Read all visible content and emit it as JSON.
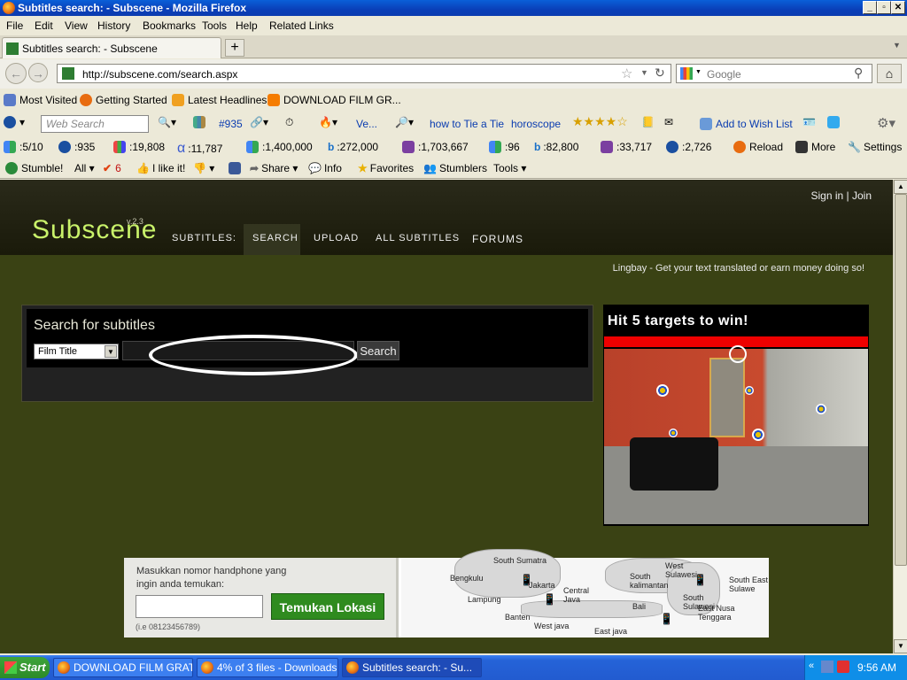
{
  "window": {
    "title": "Subtitles search: - Subscene - Mozilla Firefox"
  },
  "menu": [
    "File",
    "Edit",
    "View",
    "History",
    "Bookmarks",
    "Tools",
    "Help",
    "Related Links"
  ],
  "tab": {
    "label": "Subtitles search: - Subscene",
    "new_tab": "+"
  },
  "nav": {
    "url": "http://subscene.com/search.aspx",
    "search_placeholder": "Google"
  },
  "bookmarks": [
    "Most Visited",
    "Getting Started",
    "Latest Headlines",
    "DOWNLOAD FILM GR..."
  ],
  "toolbar1": {
    "web_search_placeholder": "Web Search",
    "rank": "#935",
    "ve": "Ve...",
    "tie": "how to Tie a Tie",
    "horoscope": "horoscope",
    "wishlist": "Add to Wish List"
  },
  "toolbar2": [
    ":5/10",
    ":935",
    ":19,808",
    ":11,787",
    ":1,400,000",
    ":272,000",
    ":1,703,667",
    ":96",
    ":82,800",
    ":33,717",
    ":2,726",
    "Reload",
    "More",
    "Settings"
  ],
  "toolbar3": {
    "stumble": "Stumble!",
    "all": "All",
    "count": "6",
    "like": "I like it!",
    "share": "Share",
    "info": "Info",
    "favorites": "Favorites",
    "stumblers": "Stumblers",
    "tools": "Tools"
  },
  "site": {
    "logo": "Subscene",
    "version": "v.2.3",
    "nav_label": "SUBTITLES:",
    "nav": [
      "SEARCH",
      "UPLOAD",
      "ALL SUBTITLES",
      "FORUMS"
    ],
    "signin": "Sign in | Join",
    "promo": "Lingbay - Get your text translated or earn money doing so!",
    "search_title": "Search for subtitles",
    "search_type": "Film Title",
    "search_button": "Search"
  },
  "ad_game": {
    "headline": "Hit 5 targets to win!"
  },
  "ad_map": {
    "prompt": "Masukkan nomor handphone yang ingin anda temukan:",
    "button": "Temukan Lokasi",
    "example": "(i.e 08123456789)",
    "places": [
      "South Sumatra",
      "Bengkulu",
      "Lampung",
      "Jakarta",
      "Banten",
      "Central Java",
      "West java",
      "East java",
      "Bali",
      "South kalimantan",
      "West Sulawesi",
      "South Sulawesi",
      "South East Sulawe",
      "East Nusa Tenggara"
    ]
  },
  "taskbar": {
    "start": "Start",
    "tasks": [
      "DOWNLOAD FILM GRATI...",
      "4% of 3 files - Downloads",
      "Subtitles search: - Su..."
    ],
    "clock": "9:56 AM"
  },
  "colors": {
    "site_bg": "#3a4214",
    "logo": "#c9f26a",
    "map_button": "#2f8b1f"
  }
}
